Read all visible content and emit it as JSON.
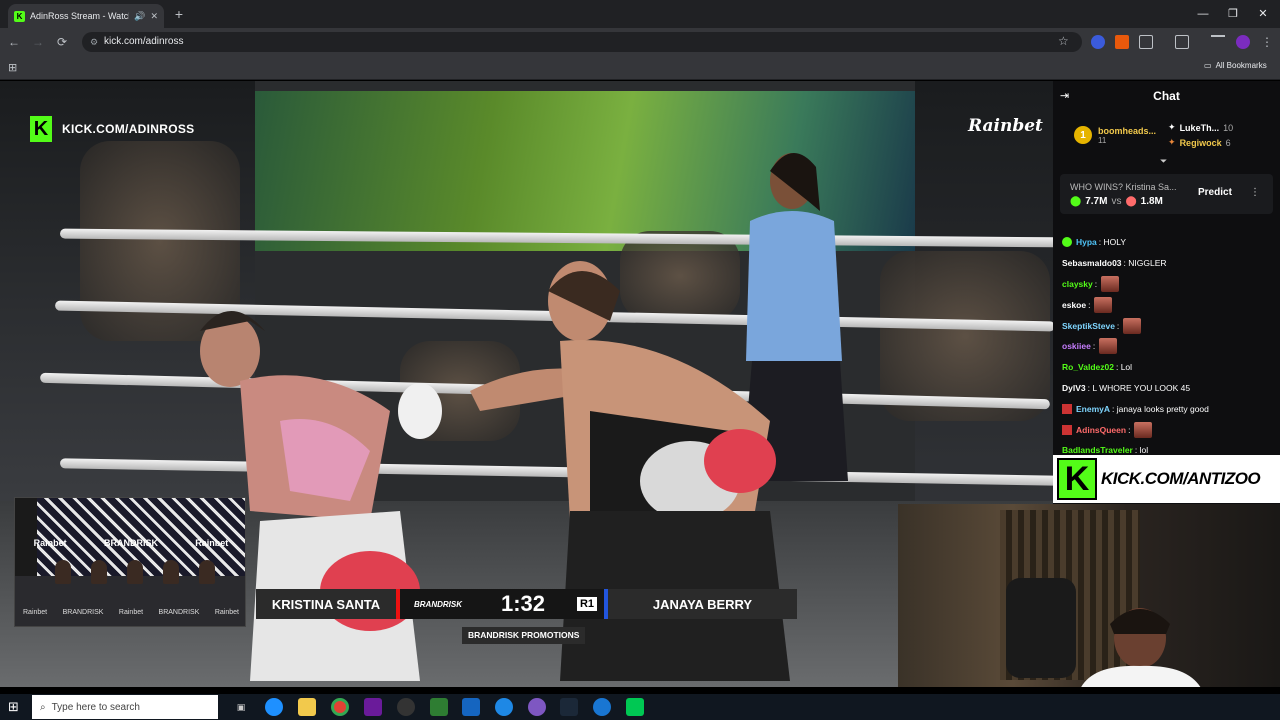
{
  "browser": {
    "tab_title": "AdinRoss Stream - Watch L",
    "tab_favicon": "K",
    "new_tab": "+",
    "url": "kick.com/adinross",
    "bookmarks_label": "All Bookmarks",
    "window_min": "—",
    "window_max": "❐",
    "window_close": "✕",
    "back": "←",
    "forward": "→",
    "reload": "⟳"
  },
  "stream": {
    "channel_badge": "KICK.COM/ADINROSS",
    "kick_logo": "K",
    "sponsor": "Rainbet",
    "inset_brands": [
      "Rainbet",
      "BRANDRISK",
      "Rainbet"
    ],
    "inset_tags": [
      "Rainbet",
      "BRANDRISK",
      "Rainbet",
      "BRANDRISK",
      "Rainbet"
    ]
  },
  "scoreboard": {
    "fighter1": "KRISTINA SANTA",
    "promotion_logo": "BRANDRISK",
    "clock": "1:32",
    "round": "R1",
    "fighter2": "JANAYA BERRY",
    "banner": "BRANDRISK PROMOTIONS"
  },
  "chat": {
    "title": "Chat",
    "top_gifter": {
      "rank": "1",
      "name": "boomheads...",
      "count": "11"
    },
    "gifters": [
      {
        "name": "LukeTh...",
        "count": "10",
        "color": "#ffffff"
      },
      {
        "name": "Regiwock",
        "count": "6",
        "color": "#f2c94c"
      }
    ],
    "prediction": {
      "question": "WHO WINS? Kristina Sa...",
      "option_a": "7.7M",
      "vs": "vs",
      "option_b": "1.8M",
      "button": "Predict"
    },
    "messages": [
      {
        "user": "Hypa",
        "text": ": HOLY",
        "color": "#4fc3f7",
        "emote": false
      },
      {
        "user": "Sebasmaldo03",
        "text": ": NIGGLER",
        "color": "#ffffff",
        "emote": false
      },
      {
        "user": "claysky",
        "text": ":",
        "color": "#53fc18",
        "emote": true
      },
      {
        "user": "eskoe",
        "text": ":",
        "color": "#ffffff",
        "emote": true
      },
      {
        "user": "SkeptikSteve",
        "text": ":",
        "color": "#7fd6ff",
        "emote": true
      },
      {
        "user": "oskiiee",
        "text": ":",
        "color": "#c77dff",
        "emote": true
      },
      {
        "user": "Ro_Valdez02",
        "text": ": Lol",
        "color": "#53fc18",
        "emote": false
      },
      {
        "user": "DylV3",
        "text": ": L WHORE YOU LOOK 45",
        "color": "#ffffff",
        "emote": false
      },
      {
        "user": "EnemyA",
        "text": ": janaya looks pretty good",
        "color": "#7fd6ff",
        "emote": false
      },
      {
        "user": "AdinsQueen",
        "text": ":",
        "color": "#ff6b6b",
        "emote": true
      },
      {
        "user": "BadlandsTraveler",
        "text": ": lol",
        "color": "#53fc18",
        "emote": false
      }
    ]
  },
  "overlay": {
    "kick_logo": "K",
    "url": "KICK.COM/ANTIZOO"
  },
  "taskbar": {
    "search_placeholder": "Type here to search",
    "start_icon": "⊞"
  }
}
